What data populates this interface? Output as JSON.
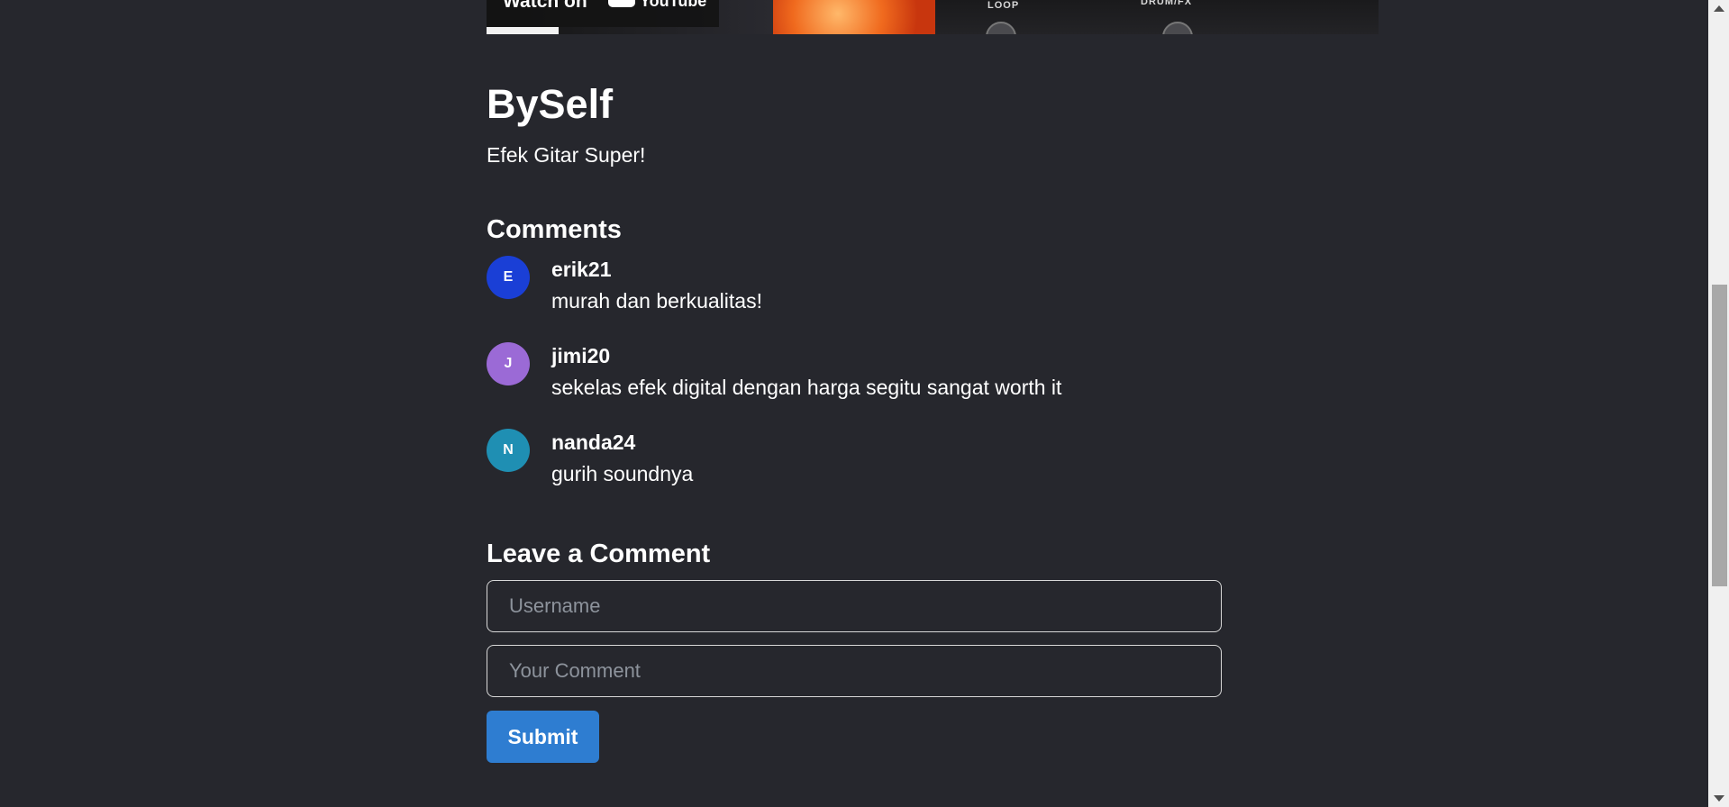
{
  "video": {
    "watch_on_label": "Watch on",
    "youtube_label": "YouTube",
    "pedal_labels": [
      "LOOP",
      "DRUM/FX"
    ]
  },
  "product": {
    "title": "BySelf",
    "description": "Efek Gitar Super!"
  },
  "comments_section": {
    "heading": "Comments",
    "items": [
      {
        "initial": "E",
        "username": "erik21",
        "text": "murah dan berkualitas!",
        "avatar_color": "#1a3fd6"
      },
      {
        "initial": "J",
        "username": "jimi20",
        "text": "sekelas efek digital dengan harga segitu sangat worth it",
        "avatar_color": "#9b6ad6"
      },
      {
        "initial": "N",
        "username": "nanda24",
        "text": "gurih soundnya",
        "avatar_color": "#1f8fb3"
      }
    ]
  },
  "comment_form": {
    "heading": "Leave a Comment",
    "username_placeholder": "Username",
    "comment_placeholder": "Your Comment",
    "submit_label": "Submit"
  },
  "colors": {
    "background": "#26272d",
    "accent": "#2e7dd1",
    "text": "#ffffff",
    "placeholder": "#8d939c"
  }
}
